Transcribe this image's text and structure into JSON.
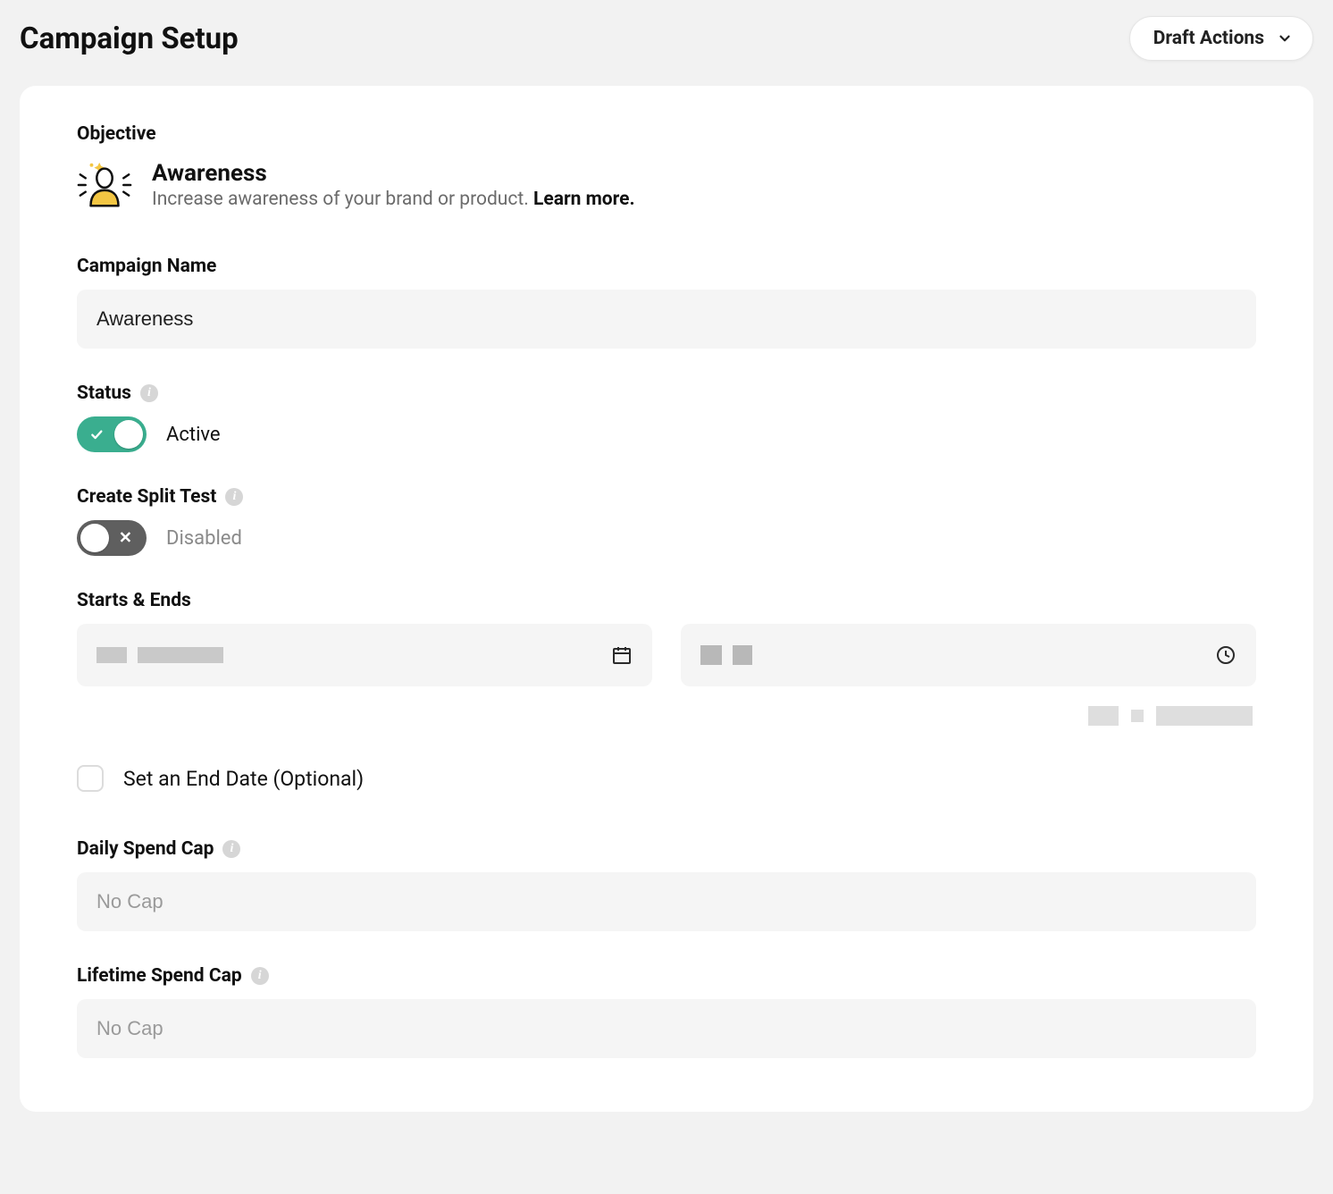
{
  "header": {
    "title": "Campaign Setup",
    "draft_actions_label": "Draft Actions"
  },
  "objective": {
    "label": "Objective",
    "title": "Awareness",
    "description_prefix": "Increase awareness of your brand or product. ",
    "learn_more": "Learn more."
  },
  "campaign_name": {
    "label": "Campaign Name",
    "value": "Awareness"
  },
  "status": {
    "label": "Status",
    "state_label": "Active",
    "on": true
  },
  "split_test": {
    "label": "Create Split Test",
    "state_label": "Disabled",
    "on": false
  },
  "schedule": {
    "label": "Starts & Ends",
    "end_date_checkbox_label": "Set an End Date (Optional)"
  },
  "daily_spend_cap": {
    "label": "Daily Spend Cap",
    "placeholder": "No Cap"
  },
  "lifetime_spend_cap": {
    "label": "Lifetime Spend Cap",
    "placeholder": "No Cap"
  }
}
